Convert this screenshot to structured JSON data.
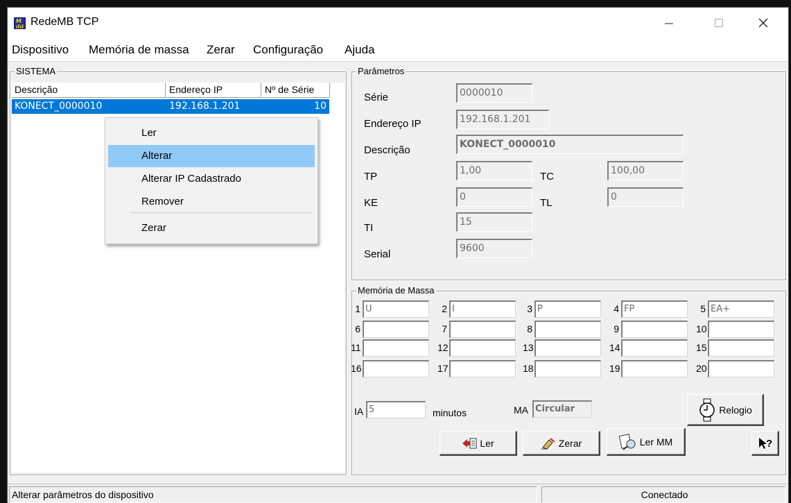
{
  "window": {
    "title": "RedeMB TCP",
    "icon": "app-logo-icon"
  },
  "menu": [
    "Dispositivo",
    "Memória de massa",
    "Zerar",
    "Configuração",
    "Ajuda"
  ],
  "sistema": {
    "title": "SISTEMA",
    "columns": [
      "Descrição",
      "Endereço IP",
      "Nº de Série"
    ],
    "rows": [
      {
        "descricao": "KONECT_0000010",
        "ip": "192.168.1.201",
        "serie": "10",
        "selected": true
      }
    ]
  },
  "context_menu": {
    "items": [
      "Ler",
      "Alterar",
      "Alterar IP Cadastrado",
      "Remover",
      "Zerar"
    ],
    "highlighted": "Alterar"
  },
  "parametros": {
    "title": "Parâmetros",
    "serie_label": "Série",
    "serie": "0000010",
    "ip_label": "Endereço IP",
    "ip": "192.168.1.201",
    "descricao_label": "Descrição",
    "descricao": "KONECT_0000010",
    "tp_label": "TP",
    "tp": "1,00",
    "tc_label": "TC",
    "tc": "100,00",
    "ke_label": "KE",
    "ke": "0",
    "tl_label": "TL",
    "tl": "0",
    "ti_label": "TI",
    "ti": "15",
    "serial_label": "Serial",
    "serial": "9600"
  },
  "memoria": {
    "title": "Memória de Massa",
    "channels": [
      {
        "n": "1",
        "v": "U"
      },
      {
        "n": "2",
        "v": "I"
      },
      {
        "n": "3",
        "v": "P"
      },
      {
        "n": "4",
        "v": "FP"
      },
      {
        "n": "5",
        "v": "EA+"
      },
      {
        "n": "6",
        "v": ""
      },
      {
        "n": "7",
        "v": ""
      },
      {
        "n": "8",
        "v": ""
      },
      {
        "n": "9",
        "v": ""
      },
      {
        "n": "10",
        "v": ""
      },
      {
        "n": "11",
        "v": ""
      },
      {
        "n": "12",
        "v": ""
      },
      {
        "n": "13",
        "v": ""
      },
      {
        "n": "14",
        "v": ""
      },
      {
        "n": "15",
        "v": ""
      },
      {
        "n": "16",
        "v": ""
      },
      {
        "n": "17",
        "v": ""
      },
      {
        "n": "18",
        "v": ""
      },
      {
        "n": "19",
        "v": ""
      },
      {
        "n": "20",
        "v": ""
      }
    ],
    "ia_label": "IA",
    "ia": "5",
    "minutos_label": "minutos",
    "ma_label": "MA",
    "ma": "Circular",
    "relogio_label": "Relogio"
  },
  "buttons": {
    "ler": "Ler",
    "zerar": "Zerar",
    "ler_mm": "Ler MM"
  },
  "status": {
    "left": "Alterar parâmetros do dispositivo",
    "right": "Conectado"
  },
  "colors": {
    "selection": "#0078d7",
    "menu_highlight": "#91c9f7"
  }
}
